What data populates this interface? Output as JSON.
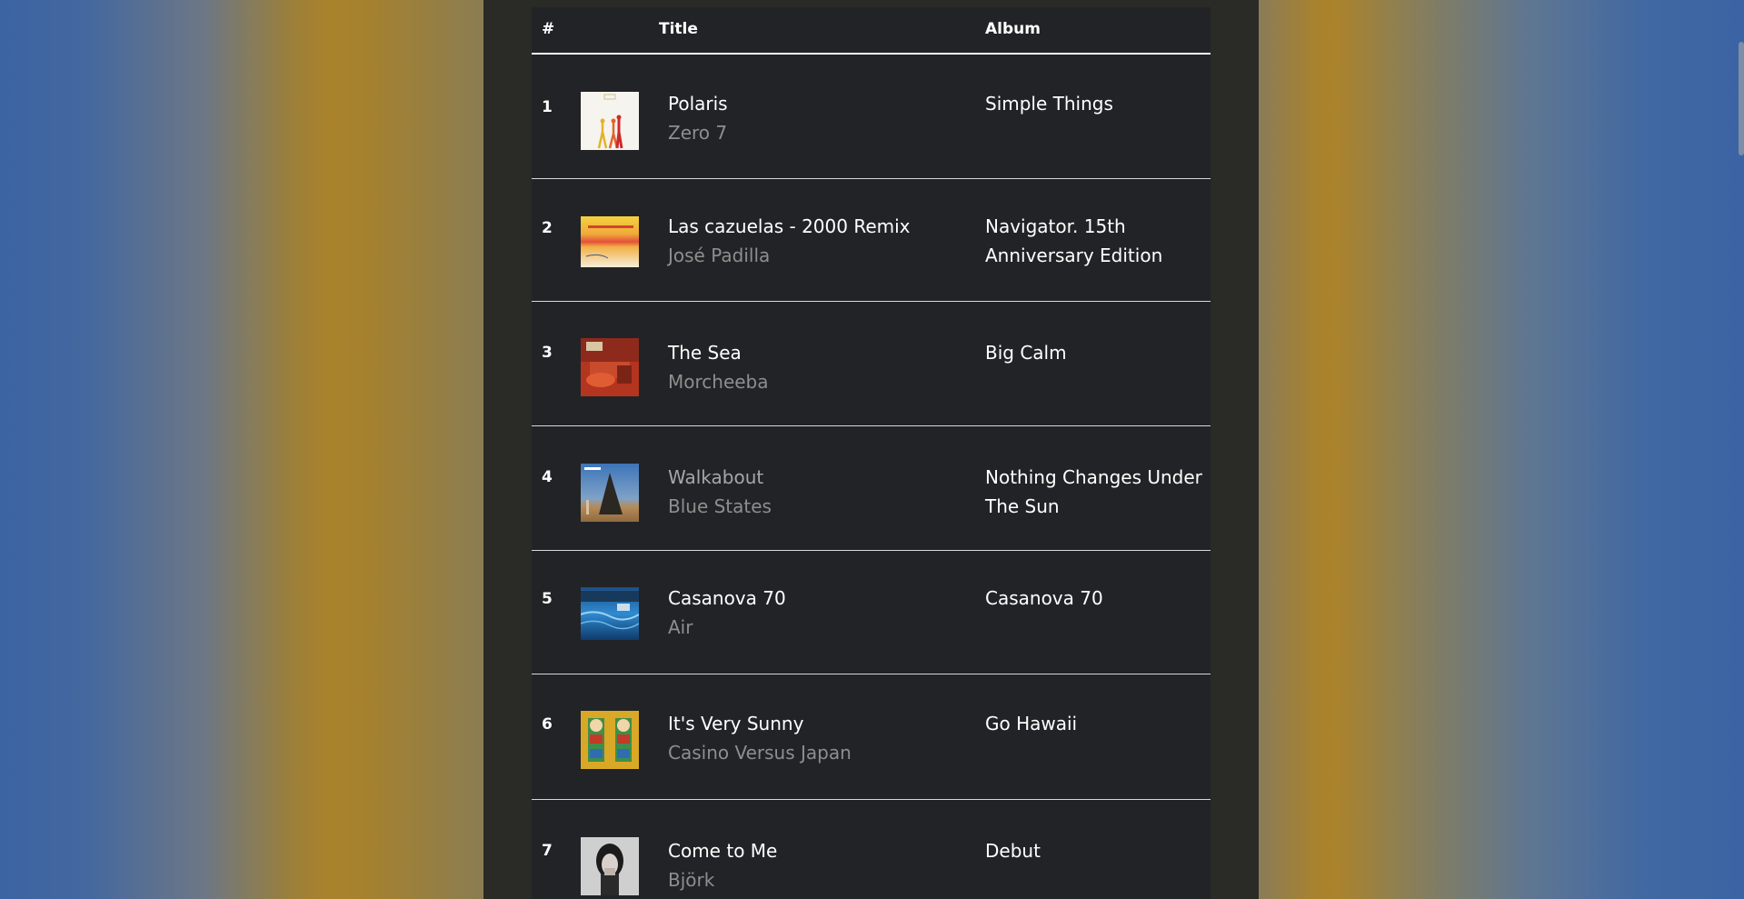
{
  "header": {
    "num": "#",
    "title": "Title",
    "album": "Album"
  },
  "rows": [
    {
      "num": "1",
      "title": "Polaris",
      "artist": "Zero 7",
      "album": "Simple Things",
      "art": "polaris-cover"
    },
    {
      "num": "2",
      "title": "Las cazuelas - 2000 Remix",
      "artist": "José Padilla",
      "album": "Navigator. 15th Anniversary Edition",
      "art": "navigator-cover"
    },
    {
      "num": "3",
      "title": "The Sea",
      "artist": "Morcheeba",
      "album": "Big Calm",
      "art": "big-calm-cover"
    },
    {
      "num": "4",
      "title": "Walkabout",
      "artist": "Blue States",
      "album": "Nothing Changes Under The Sun",
      "art": "nothing-changes-cover"
    },
    {
      "num": "5",
      "title": "Casanova 70",
      "artist": "Air",
      "album": "Casanova 70",
      "art": "casanova-cover"
    },
    {
      "num": "6",
      "title": "It's Very Sunny",
      "artist": "Casino Versus Japan",
      "album": "Go Hawaii",
      "art": "go-hawaii-cover"
    },
    {
      "num": "7",
      "title": "Come to Me",
      "artist": "Björk",
      "album": "Debut",
      "art": "debut-cover"
    }
  ]
}
